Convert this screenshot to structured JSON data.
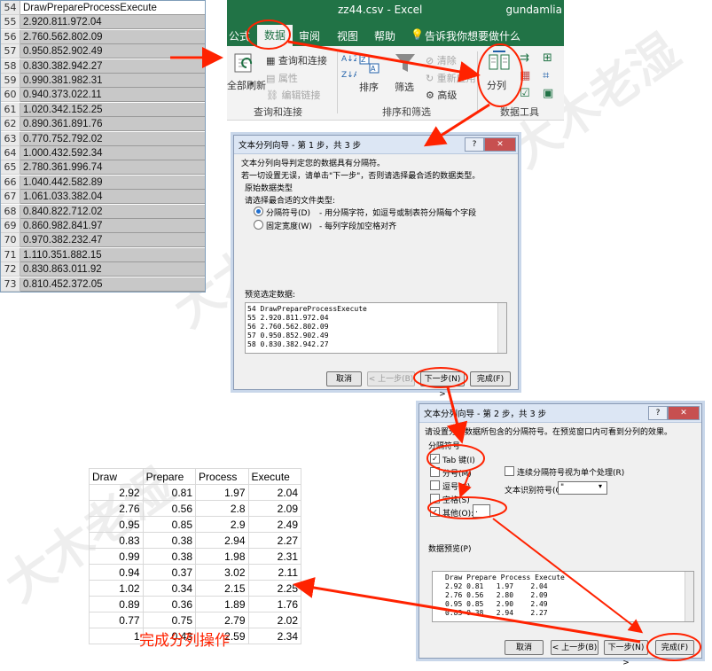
{
  "sheet": {
    "rows": [
      {
        "n": "54",
        "v": "DrawPrepareProcessExecute",
        "header": true
      },
      {
        "n": "55",
        "v": "2.920.811.972.04"
      },
      {
        "n": "56",
        "v": "2.760.562.802.09"
      },
      {
        "n": "57",
        "v": "0.950.852.902.49"
      },
      {
        "n": "58",
        "v": "0.830.382.942.27"
      },
      {
        "n": "59",
        "v": "0.990.381.982.31"
      },
      {
        "n": "60",
        "v": "0.940.373.022.11"
      },
      {
        "n": "61",
        "v": "1.020.342.152.25"
      },
      {
        "n": "62",
        "v": "0.890.361.891.76"
      },
      {
        "n": "63",
        "v": "0.770.752.792.02"
      },
      {
        "n": "64",
        "v": "1.000.432.592.34"
      },
      {
        "n": "65",
        "v": "2.780.361.996.74"
      },
      {
        "n": "66",
        "v": "1.040.442.582.89"
      },
      {
        "n": "67",
        "v": "1.061.033.382.04"
      },
      {
        "n": "68",
        "v": "0.840.822.712.02"
      },
      {
        "n": "69",
        "v": "0.860.982.841.97"
      },
      {
        "n": "70",
        "v": "0.970.382.232.47"
      },
      {
        "n": "71",
        "v": "1.110.351.882.15"
      },
      {
        "n": "72",
        "v": "0.830.863.011.92"
      },
      {
        "n": "73",
        "v": "0.810.452.372.05"
      }
    ]
  },
  "ribbon": {
    "title": "zz44.csv  -  Excel",
    "user": "gundamlia",
    "tabs": [
      "公式",
      "数据",
      "审阅",
      "视图",
      "帮助"
    ],
    "tell_me": "告诉我你想要做什么",
    "btn_refresh": "全部刷新",
    "btn_query": "查询和连接",
    "btn_props": "属性",
    "btn_edit_links": "编辑链接",
    "btn_sort": "排序",
    "btn_filter": "筛选",
    "btn_clear": "清除",
    "btn_reapply": "重新应用",
    "btn_advanced": "高级",
    "btn_split": "分列",
    "grp_query": "查询和连接",
    "grp_sort": "排序和筛选",
    "grp_tools": "数据工具"
  },
  "wizard1": {
    "caption": "文本分列向导 - 第 1 步，共 3 步",
    "line1": "文本分列向导判定您的数据具有分隔符。",
    "line2": "若一切设置无误，请单击\"下一步\"，否则请选择最合适的数据类型。",
    "section": "原始数据类型",
    "choose": "请选择最合适的文件类型:",
    "opt_delim": "分隔符号(D)",
    "opt_delim_desc": "- 用分隔字符，如逗号或制表符分隔每个字段",
    "opt_fixed": "固定宽度(W)",
    "opt_fixed_desc": "- 每列字段加空格对齐",
    "preview_label": "预览选定数据:",
    "preview_nums": [
      "54",
      "55",
      "56",
      "57",
      "58"
    ],
    "preview_lines": [
      "DrawPrepareProcessExecute",
      "2.920.811.972.04",
      "2.760.562.802.09",
      "0.950.852.902.49",
      "0.830.382.942.27"
    ],
    "btn_cancel": "取消",
    "btn_back": "< 上一步(B)",
    "btn_next": "下一步(N) >",
    "btn_finish": "完成(F)"
  },
  "wizard2": {
    "caption": "文本分列向导 - 第 2 步，共 3 步",
    "line1": "请设置分列数据所包含的分隔符号。在预览窗口内可看到分列的效果。",
    "section": "分隔符号",
    "tab": "Tab 键(I)",
    "semicolon": "分号(M)",
    "comma": "逗号(C)",
    "space": "空格(S)",
    "other": "其他(O):",
    "other_value": ".",
    "consecutive": "连续分隔符号视为单个处理(R)",
    "qualifier": "文本识别符号(Q):",
    "qualifier_value": "\"",
    "preview_label": "数据预览(P)",
    "preview_lines": [
      "Draw Prepare Process Execute",
      "2.92 0.81   1.97    2.04",
      "2.76 0.56   2.80    2.09",
      "0.95 0.85   2.90    2.49",
      "0.83 0.38   2.94    2.27"
    ],
    "btn_cancel": "取消",
    "btn_back": "< 上一步(B)",
    "btn_next": "下一步(N) >",
    "btn_finish": "完成(F)"
  },
  "result": {
    "headers": [
      "Draw",
      "Prepare",
      "Process",
      "Execute"
    ],
    "rows": [
      [
        "2.92",
        "0.81",
        "1.97",
        "2.04"
      ],
      [
        "2.76",
        "0.56",
        "2.8",
        "2.09"
      ],
      [
        "0.95",
        "0.85",
        "2.9",
        "2.49"
      ],
      [
        "0.83",
        "0.38",
        "2.94",
        "2.27"
      ],
      [
        "0.99",
        "0.38",
        "1.98",
        "2.31"
      ],
      [
        "0.94",
        "0.37",
        "3.02",
        "2.11"
      ],
      [
        "1.02",
        "0.34",
        "2.15",
        "2.25"
      ],
      [
        "0.89",
        "0.36",
        "1.89",
        "1.76"
      ],
      [
        "0.77",
        "0.75",
        "2.79",
        "2.02"
      ],
      [
        "1",
        "0.43",
        "2.59",
        "2.34"
      ]
    ]
  },
  "caption": "完成分列操作",
  "colors": {
    "excel_green": "#217346",
    "annotation_red": "#ff2200"
  }
}
